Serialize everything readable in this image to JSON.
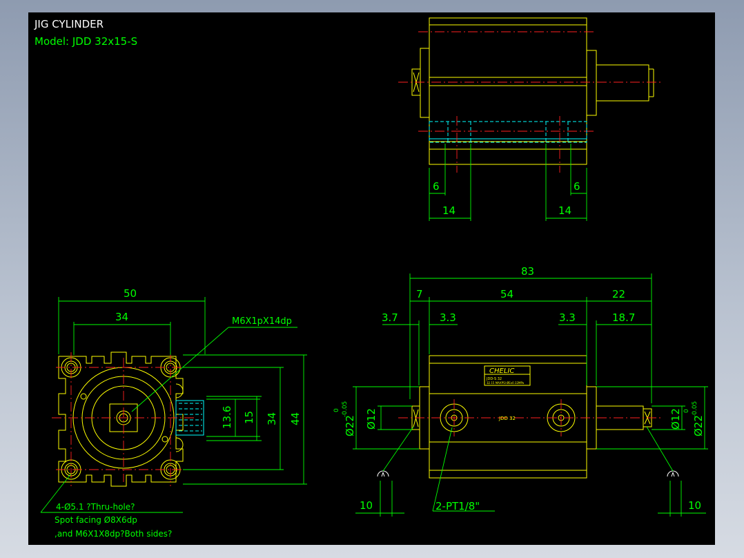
{
  "title": {
    "heading": "JIG CYLINDER",
    "model": "Model:  JDD 32x15-S"
  },
  "top_view": {
    "dim_left_small": "6",
    "dim_right_small": "6",
    "dim_left_large": "14",
    "dim_right_large": "14"
  },
  "end_view": {
    "dim_width_outer": "50",
    "dim_width_inner": "34",
    "dim_h_13_6": "13.6",
    "dim_h_15": "15",
    "dim_h_34": "34",
    "dim_h_44": "44",
    "callout_thread": "M6X1pX14dp",
    "note_line1": "4-Ø5.1 ?Thru-hole?",
    "note_line2": "Spot facing Ø8X6dp",
    "note_line3": ",and M6X1X8dp?Both sides?"
  },
  "side_view": {
    "dim_overall": "83",
    "dim_7": "7",
    "dim_54": "54",
    "dim_22": "22",
    "dim_3_7": "3.7",
    "dim_3_3_left": "3.3",
    "dim_3_3_right": "3.3",
    "dim_18_7": "18.7",
    "dim_dia12_left": "Ø12",
    "dim_dia22_left": "Ø22",
    "tol_left_upper": "0",
    "tol_left_lower": "-0.05",
    "dim_dia12_right": "Ø12",
    "dim_dia22_right": "Ø22",
    "tol_right_upper": "0",
    "tol_right_lower": "-0.05",
    "dim_10_left": "10",
    "dim_10_right": "10",
    "port_note": "2-PT1/8\"",
    "brand": "CHELIC",
    "label_small1": "JDD-S 32",
    "label_small2": "32.15 MAXPSI  ØEx0.32MPa",
    "body_text": "JDD  32"
  }
}
